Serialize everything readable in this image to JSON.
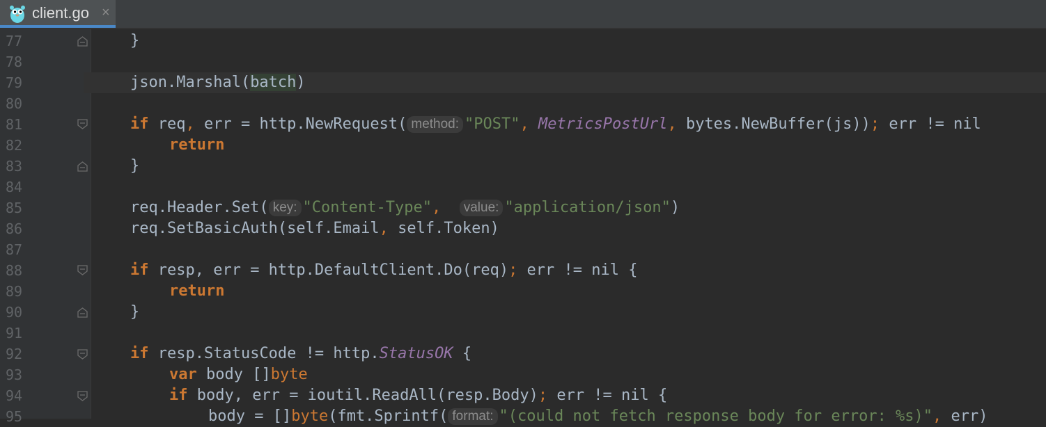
{
  "tab": {
    "filename": "client.go",
    "close": "×"
  },
  "gutter": {
    "line_numbers": [
      "77",
      "78",
      "79",
      "80",
      "81",
      "82",
      "83",
      "84",
      "85",
      "86",
      "87",
      "88",
      "89",
      "90",
      "91",
      "92",
      "93",
      "94",
      "95"
    ]
  },
  "code": {
    "l77": {
      "brace": "}"
    },
    "l79": {
      "pre": "json.Marshal(",
      "arg": "batch",
      "post": ")"
    },
    "l81": {
      "kw": "if",
      "vars": " req",
      "comma": ",",
      "mid": " err = http.NewRequest(",
      "hint": "method:",
      "s1": "\"POST\"",
      "comma2": ",",
      "sp": " ",
      "const": "MetricsPostUrl",
      "comma3": ",",
      "tail": " bytes.NewBuffer(js))",
      "semi": ";",
      "end": " err != nil"
    },
    "l82": {
      "kw": "return"
    },
    "l83": {
      "brace": "}"
    },
    "l85": {
      "pre": "req.Header.Set(",
      "hint1": "key:",
      "s1": "\"Content-Type\"",
      "comma": ",",
      "sp": "  ",
      "hint2": "value:",
      "s2": "\"application/json\"",
      "post": ")"
    },
    "l86": {
      "pre": "req.SetBasicAuth(self.Email",
      "comma": ",",
      "post": " self.Token)"
    },
    "l88": {
      "kw": "if",
      "mid": " resp, err = http.DefaultClient.Do(req)",
      "semi": ";",
      "end": " err != nil {"
    },
    "l89": {
      "kw": "return"
    },
    "l90": {
      "brace": "}"
    },
    "l92": {
      "kw": "if",
      "mid": " resp.StatusCode != http.",
      "const": "StatusOK",
      "end": " {"
    },
    "l93": {
      "kw": "var",
      "mid": " body []",
      "type": "byte"
    },
    "l94": {
      "kw": "if",
      "mid": " body, err = ioutil.ReadAll(resp.Body)",
      "semi": ";",
      "end": " err != nil {"
    },
    "l95": {
      "pre": "body = []",
      "type": "byte",
      "mid": "(fmt.Sprintf(",
      "hint": "format:",
      "s1": "\"(could not fetch response body for error: %s)\"",
      "comma": ",",
      "end": " err)"
    }
  },
  "colors": {
    "background": "#2b2b2b",
    "keyword": "#cc7832",
    "string": "#6a8759",
    "constant": "#9876aa",
    "text": "#a9b7c6",
    "tab_accent": "#4a88c7"
  }
}
